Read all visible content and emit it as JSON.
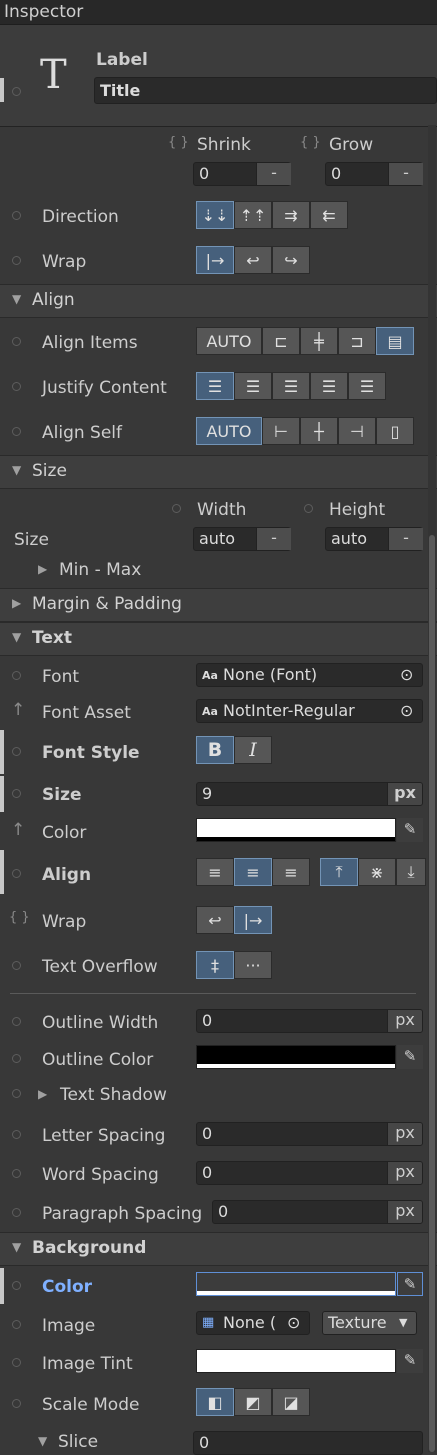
{
  "window": {
    "title": "Inspector"
  },
  "header": {
    "type_label": "Label",
    "name_value": "Title",
    "icon": "text-T-icon"
  },
  "flex": {
    "shrink_label": "Shrink",
    "grow_label": "Grow",
    "shrink_value": "0",
    "grow_value": "0",
    "minus": "-",
    "direction_label": "Direction",
    "wrap_label": "Wrap"
  },
  "align": {
    "section": "Align",
    "items_label": "Align Items",
    "justify_label": "Justify Content",
    "self_label": "Align Self",
    "auto": "AUTO"
  },
  "size": {
    "section": "Size",
    "width_label": "Width",
    "height_label": "Height",
    "size_label": "Size",
    "width_value": "auto",
    "height_value": "auto",
    "minmax_label": "Min - Max"
  },
  "margin": {
    "section": "Margin & Padding"
  },
  "text": {
    "section": "Text",
    "font_label": "Font",
    "font_value": "None (Font)",
    "font_asset_label": "Font Asset",
    "font_asset_value": "NotInter-Regular",
    "font_style_label": "Font Style",
    "bold_btn": "B",
    "italic_btn": "I",
    "size_label": "Size",
    "size_value": "9",
    "px": "px",
    "color_label": "Color",
    "align_label": "Align",
    "wrap_label": "Wrap",
    "overflow_label": "Text Overflow",
    "outline_width_label": "Outline Width",
    "outline_width_value": "0",
    "outline_color_label": "Outline Color",
    "text_shadow_label": "Text Shadow",
    "letter_spacing_label": "Letter Spacing",
    "letter_spacing_value": "0",
    "word_spacing_label": "Word Spacing",
    "word_spacing_value": "0",
    "paragraph_spacing_label": "Paragraph Spacing",
    "paragraph_spacing_value": "0"
  },
  "background": {
    "section": "Background",
    "color_label": "Color",
    "image_label": "Image",
    "image_value": "None (",
    "texture_value": "Texture",
    "tint_label": "Image Tint",
    "scale_mode_label": "Scale Mode",
    "slice_label": "Slice",
    "slice_value": "0"
  },
  "colors": {
    "accent": "#46607c",
    "highlight_label": "#7fb0ff",
    "bg": "#383838"
  }
}
